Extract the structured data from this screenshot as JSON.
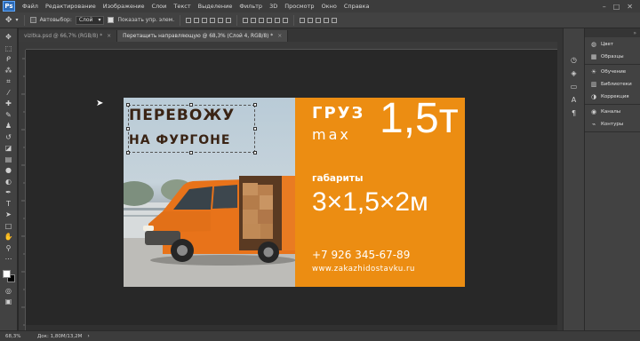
{
  "menu": {
    "logo": "Ps",
    "items": [
      "Файл",
      "Редактирование",
      "Изображение",
      "Слои",
      "Текст",
      "Выделение",
      "Фильтр",
      "3D",
      "Просмотр",
      "Окно",
      "Справка"
    ],
    "window_controls": [
      "–",
      "□",
      "✕"
    ]
  },
  "options_bar": {
    "autoselect_label": "Автовыбор:",
    "autoselect_value": "Слой",
    "show_controls_label": "Показать упр. элем."
  },
  "tabs": [
    {
      "label": "vizitka.psd @ 66,7% (RGB/8) *",
      "close": "×"
    },
    {
      "label": "Перетащить направляющую @ 68,3% (Слой 4, RGB/8) *",
      "close": "×"
    }
  ],
  "document": {
    "headline_line1": "ПЕРЕВОЖУ",
    "headline_line2": "НА ФУРГОНЕ",
    "cargo_label": "ГРУЗ",
    "max_label": "max",
    "weight": "1,5т",
    "dimensions_label": "габариты",
    "dimensions_value": "3×1,5×2м",
    "phone": "+7 926 345-67-89",
    "website": "www.zakazhidostavku.ru",
    "colors": {
      "orange": "#ec8d12",
      "headline": "#3a2415",
      "van": "#e8731a"
    }
  },
  "right_panels": {
    "group1": [
      {
        "icon": "color-wheel-icon",
        "label": "Цвет"
      },
      {
        "icon": "grid-icon",
        "label": "Образцы"
      }
    ],
    "group2": [
      {
        "icon": "bulb-icon",
        "label": "Обучение"
      },
      {
        "icon": "library-icon",
        "label": "Библиотеки"
      },
      {
        "icon": "adjustment-icon",
        "label": "Коррекция"
      }
    ],
    "group3": [
      {
        "icon": "channels-icon",
        "label": "Каналы"
      },
      {
        "icon": "paths-icon",
        "label": "Контуры"
      }
    ]
  },
  "status": {
    "zoom": "68,3%",
    "doc_info": "Док: 1,80M/13,2M",
    "arrow": "›"
  }
}
